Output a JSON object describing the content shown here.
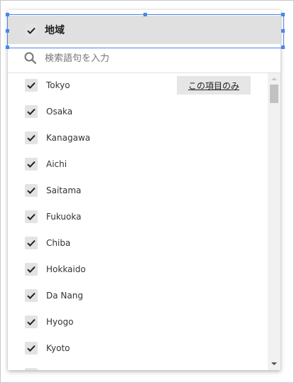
{
  "header": {
    "label": "地域",
    "checked": true
  },
  "search": {
    "placeholder": "検索語句を入力",
    "value": ""
  },
  "only_button_label": "この項目のみ",
  "items": [
    {
      "label": "Tokyo",
      "checked": true
    },
    {
      "label": "Osaka",
      "checked": true
    },
    {
      "label": "Kanagawa",
      "checked": true
    },
    {
      "label": "Aichi",
      "checked": true
    },
    {
      "label": "Saitama",
      "checked": true
    },
    {
      "label": "Fukuoka",
      "checked": true
    },
    {
      "label": "Chiba",
      "checked": true
    },
    {
      "label": "Hokkaido",
      "checked": true
    },
    {
      "label": "Da Nang",
      "checked": true
    },
    {
      "label": "Hyogo",
      "checked": true
    },
    {
      "label": "Kyoto",
      "checked": true
    },
    {
      "label": "",
      "checked": true
    }
  ],
  "icons": {
    "header_check": "check-icon",
    "search": "search-icon",
    "scroll_up": "scroll-up-arrow-icon",
    "scroll_down": "scroll-down-arrow-icon"
  },
  "colors": {
    "selection_border": "#4a86e8",
    "header_background": "#e0e0e0",
    "checkbox_background": "#e3e3e3",
    "only_button_background": "#e6e6e6"
  }
}
